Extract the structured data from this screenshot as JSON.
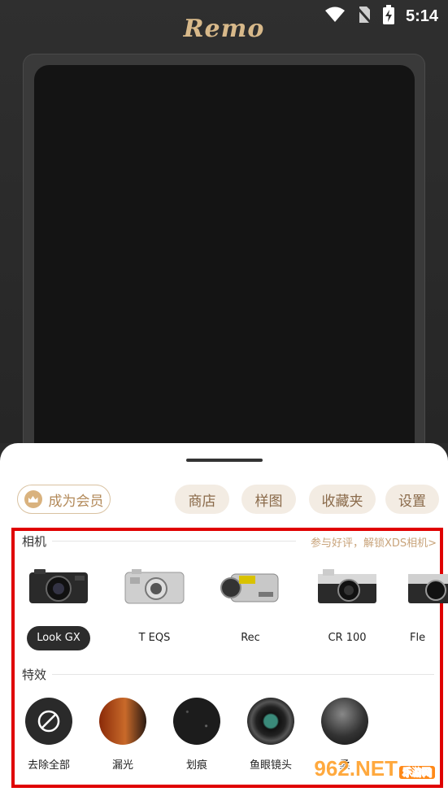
{
  "status": {
    "time": "5:14"
  },
  "app": {
    "logo": "Remo"
  },
  "toolbar": {
    "member": "成为会员",
    "shop": "商店",
    "samples": "样图",
    "favorites": "收藏夹",
    "settings": "设置"
  },
  "cameras": {
    "title": "相机",
    "promo": "参与好评，解锁XDS相机>",
    "items": [
      {
        "label": "Look GX",
        "selected": true
      },
      {
        "label": "T EQS",
        "selected": false
      },
      {
        "label": "Rec",
        "selected": false
      },
      {
        "label": "CR 100",
        "selected": false
      },
      {
        "label": "Fle",
        "selected": false
      }
    ]
  },
  "effects": {
    "title": "特效",
    "items": [
      {
        "label": "去除全部",
        "icon": "no-icon"
      },
      {
        "label": "漏光"
      },
      {
        "label": "划痕"
      },
      {
        "label": "鱼眼镜头"
      },
      {
        "label": "柔"
      }
    ]
  },
  "watermark": {
    "text": "962",
    "suffix": ".NET",
    "sub": "乐游网"
  },
  "colors": {
    "accent": "#d8b98a",
    "highlight": "#e00000"
  }
}
